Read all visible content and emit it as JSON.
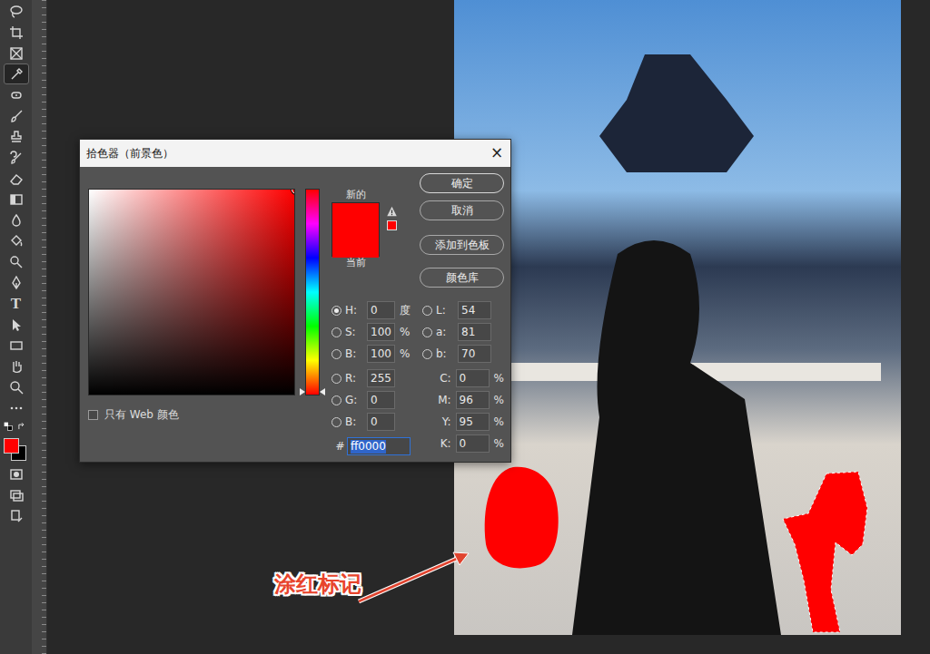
{
  "toolbar": {
    "tools": [
      {
        "selected": false
      },
      {
        "selected": false
      },
      {
        "selected": false
      },
      {
        "selected": true
      },
      {
        "selected": false
      },
      {
        "selected": false
      },
      {
        "selected": false
      },
      {
        "selected": false
      },
      {
        "selected": false
      },
      {
        "selected": false
      },
      {
        "selected": false
      },
      {
        "selected": false
      },
      {
        "selected": false
      },
      {
        "selected": false
      },
      {
        "selected": false,
        "label": "T"
      },
      {
        "selected": false
      },
      {
        "selected": false
      },
      {
        "selected": false
      },
      {
        "selected": false
      },
      {
        "selected": false
      }
    ],
    "foreground_color": "#ff0000",
    "background_color": "#000000"
  },
  "dialog": {
    "title": "拾色器（前景色）",
    "close": "×",
    "picker": {
      "hue_level": 0,
      "saturation_level": 1,
      "brightness_level": 1
    },
    "new_label": "新的",
    "current_label": "当前",
    "new_color": "#ff0000",
    "current_color": "#ff0000",
    "gamut_color": "#ff0000",
    "web_only": {
      "label": "只有 Web 颜色",
      "checked": false
    },
    "buttons": [
      {
        "label": "确定",
        "default": true
      },
      {
        "label": "取消",
        "default": false
      },
      {
        "label": "添加到色板",
        "default": false
      },
      {
        "label": "颜色库",
        "default": false
      }
    ],
    "left_fields": [
      {
        "label": "H:",
        "value": "0",
        "unit": "度",
        "selected": true
      },
      {
        "label": "S:",
        "value": "100",
        "unit": "%",
        "selected": false
      },
      {
        "label": "B:",
        "value": "100",
        "unit": "%",
        "selected": false
      },
      {
        "label": "R:",
        "value": "255",
        "unit": "",
        "selected": false
      },
      {
        "label": "G:",
        "value": "0",
        "unit": "",
        "selected": false
      },
      {
        "label": "B:",
        "value": "0",
        "unit": "",
        "selected": false
      }
    ],
    "right_fields": [
      {
        "label": "L:",
        "value": "54",
        "unit": "",
        "selected": false,
        "kind": "radio"
      },
      {
        "label": "a:",
        "value": "81",
        "unit": "",
        "selected": false,
        "kind": "radio"
      },
      {
        "label": "b:",
        "value": "70",
        "unit": "",
        "selected": false,
        "kind": "radio"
      },
      {
        "label": "C:",
        "value": "0",
        "unit": "%",
        "selected": false,
        "kind": "plain"
      },
      {
        "label": "M:",
        "value": "96",
        "unit": "%",
        "selected": false,
        "kind": "plain"
      },
      {
        "label": "Y:",
        "value": "95",
        "unit": "%",
        "selected": false,
        "kind": "plain"
      },
      {
        "label": "K:",
        "value": "0",
        "unit": "%",
        "selected": false,
        "kind": "plain"
      }
    ],
    "hex": {
      "prefix": "#",
      "value": "ff0000",
      "text_selected": true
    }
  },
  "annotation": {
    "text": "涂红标记"
  }
}
